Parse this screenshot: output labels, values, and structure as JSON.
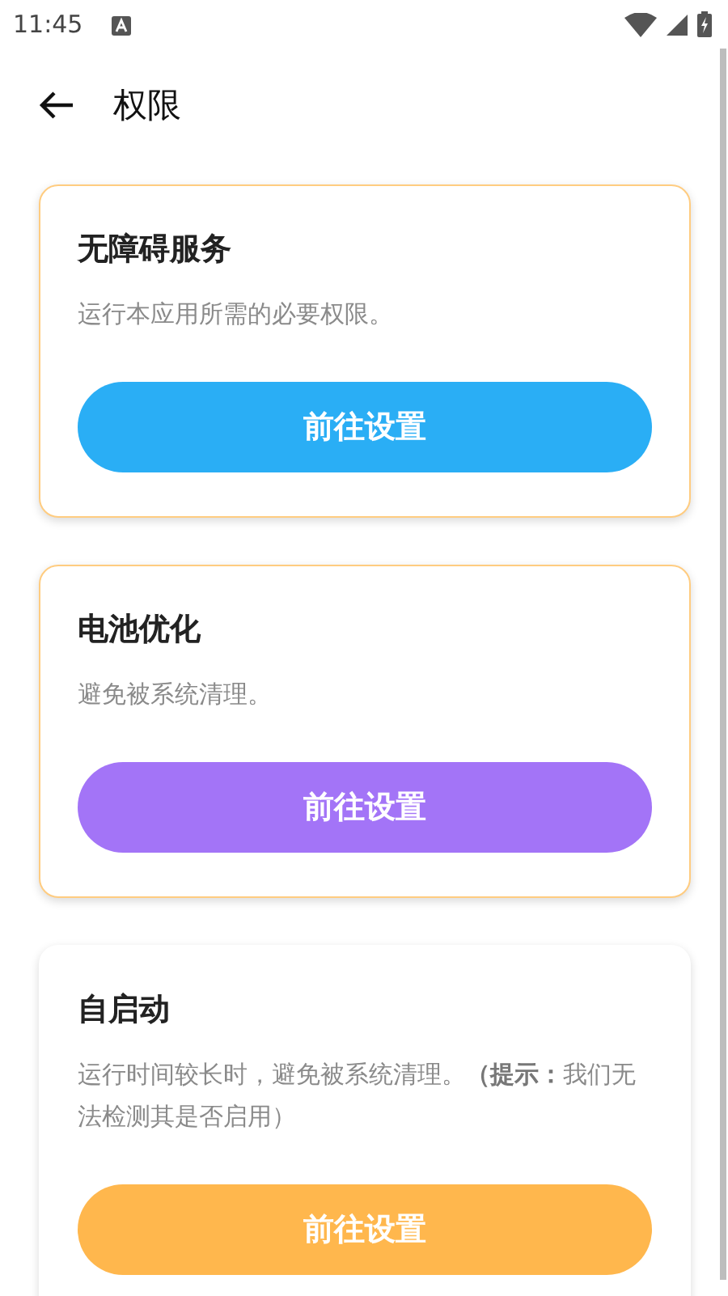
{
  "status_bar": {
    "time": "11:45"
  },
  "header": {
    "title": "权限"
  },
  "cards": [
    {
      "title": "无障碍服务",
      "description": "运行本应用所需的必要权限。",
      "button": "前往设置",
      "color": "#2aaef5",
      "highlighted": true
    },
    {
      "title": "电池优化",
      "description": "避免被系统清理。",
      "button": "前往设置",
      "color": "#a374f7",
      "highlighted": true
    },
    {
      "title": "自启动",
      "description": "运行时间较长时，避免被系统清理。**（提示：**我们无法检测其是否启用）",
      "button": "前往设置",
      "color": "#ffb74d",
      "highlighted": false
    }
  ]
}
